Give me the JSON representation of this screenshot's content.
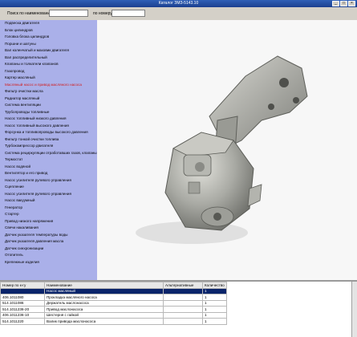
{
  "window": {
    "title": "Каталог ЗМЗ-5143.10"
  },
  "search": {
    "name_label": "Поиск по наименованию:",
    "number_label": "по номеру:",
    "name_value": "",
    "number_value": ""
  },
  "sidebar": {
    "items": [
      {
        "label": "Подвеска двигателя"
      },
      {
        "label": "Блок цилиндров"
      },
      {
        "label": "Головка блока цилиндров"
      },
      {
        "label": "Поршни и шатуны"
      },
      {
        "label": "Вал коленчатый и маховик двигателя"
      },
      {
        "label": "Вал распределительный"
      },
      {
        "label": "Клапаны и толкатели клапанов"
      },
      {
        "label": "Газопровод"
      },
      {
        "label": "Картер масляный"
      },
      {
        "label": "Масляный насос и привод масляного насоса"
      },
      {
        "label": "Фильтр очистки масла"
      },
      {
        "label": "Радиатор масляный"
      },
      {
        "label": "Система вентиляции"
      },
      {
        "label": "Трубопроводы топливные"
      },
      {
        "label": "Насос топливный низкого давления"
      },
      {
        "label": "Насос топливный высокого давления"
      },
      {
        "label": "Форсунка и топливопроводы высокого давления"
      },
      {
        "label": "Фильтр тонкой очистки топлива"
      },
      {
        "label": "Турбокомпрессор двигателя"
      },
      {
        "label": "Система рециркуляции отработавших газов, клапаны, датчики"
      },
      {
        "label": "Термостат"
      },
      {
        "label": "Насос водяной"
      },
      {
        "label": "Вентилятор и его привод"
      },
      {
        "label": "Насос усилителя рулевого управления"
      },
      {
        "label": "Сцепление"
      },
      {
        "label": "Насос усилителя рулевого управления"
      },
      {
        "label": "Насос вакуумный"
      },
      {
        "label": "Генератор"
      },
      {
        "label": "Стартер"
      },
      {
        "label": "Привод низкого напряжения"
      },
      {
        "label": "Свечи накаливания"
      },
      {
        "label": "Датчик указателя температуры воды"
      },
      {
        "label": "Датчик указателя давления масла"
      },
      {
        "label": "Датчик синхронизации"
      },
      {
        "label": "Отопитель"
      },
      {
        "label": "Крепежные изделия"
      }
    ],
    "selected_index": 9
  },
  "table": {
    "columns": [
      "Номер по к-гу",
      "Наименование",
      "Альтернативные",
      "Количество"
    ],
    "rows": [
      [
        "",
        "Насос масляный",
        "",
        "1"
      ],
      [
        "406.1011080",
        "Прокладка масляного насоса",
        "",
        "1"
      ],
      [
        "514.1011086",
        "Держатель маслонасоса",
        "",
        "1"
      ],
      [
        "514.1011236-20",
        "Привод маслонасоса",
        "",
        "1"
      ],
      [
        "406.1011236-10",
        "Шестерня с гайкой",
        "",
        "1"
      ],
      [
        "514.1011220",
        "Валик привода маслонасоса",
        "",
        "1"
      ]
    ]
  },
  "colors": {
    "sidebar_bg": "#aab0e9",
    "selected_text": "#d21a1a",
    "title_bar": "#1b3f8f"
  }
}
